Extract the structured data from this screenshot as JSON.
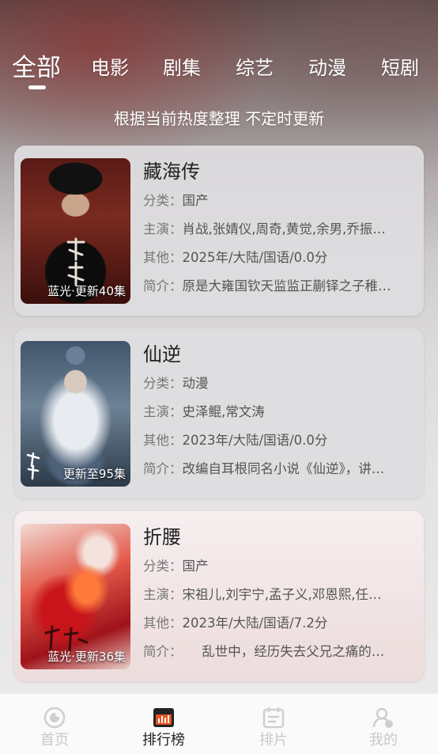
{
  "tabs": [
    {
      "label": "全部",
      "active": true
    },
    {
      "label": "电影"
    },
    {
      "label": "剧集"
    },
    {
      "label": "综艺"
    },
    {
      "label": "动漫"
    },
    {
      "label": "短剧"
    }
  ],
  "subtitle": "根据当前热度整理 不定时更新",
  "items": [
    {
      "title": "藏海传",
      "badge": "蓝光·更新40集",
      "category_label": "分类：",
      "category": "国产",
      "cast_label": "主演：",
      "cast": "肖战,张婧仪,周奇,黄觉,余男,乔振…",
      "other_label": "其他：",
      "other": "2025年/大陆/国语/0.0分",
      "intro_label": "简介：",
      "intro": "原是大雍国钦天监监正蒯铎之子稚…"
    },
    {
      "title": "仙逆",
      "badge": "更新至95集",
      "category_label": "分类：",
      "category": "动漫",
      "cast_label": "主演：",
      "cast": "史泽鲲,常文涛",
      "other_label": "其他：",
      "other": "2023年/大陆/国语/0.0分",
      "intro_label": "简介：",
      "intro": "改编自耳根同名小说《仙逆》，讲…"
    },
    {
      "title": "折腰",
      "badge": "蓝光·更新36集",
      "category_label": "分类：",
      "category": "国产",
      "cast_label": "主演：",
      "cast": "宋祖儿,刘宇宁,孟子义,邓恩熙,任…",
      "other_label": "其他：",
      "other": "2023年/大陆/国语/7.2分",
      "intro_label": "简介：",
      "intro": "　　乱世中，经历失去父兄之痛的…"
    }
  ],
  "bottom_nav": [
    {
      "label": "首页",
      "icon": "home-icon"
    },
    {
      "label": "排行榜",
      "icon": "chart-icon",
      "active": true
    },
    {
      "label": "排片",
      "icon": "calendar-icon"
    },
    {
      "label": "我的",
      "icon": "profile-icon"
    }
  ],
  "colors": {
    "accent": "#e8531f",
    "active_text": "#222222",
    "inactive_text": "#c8c8c8"
  }
}
